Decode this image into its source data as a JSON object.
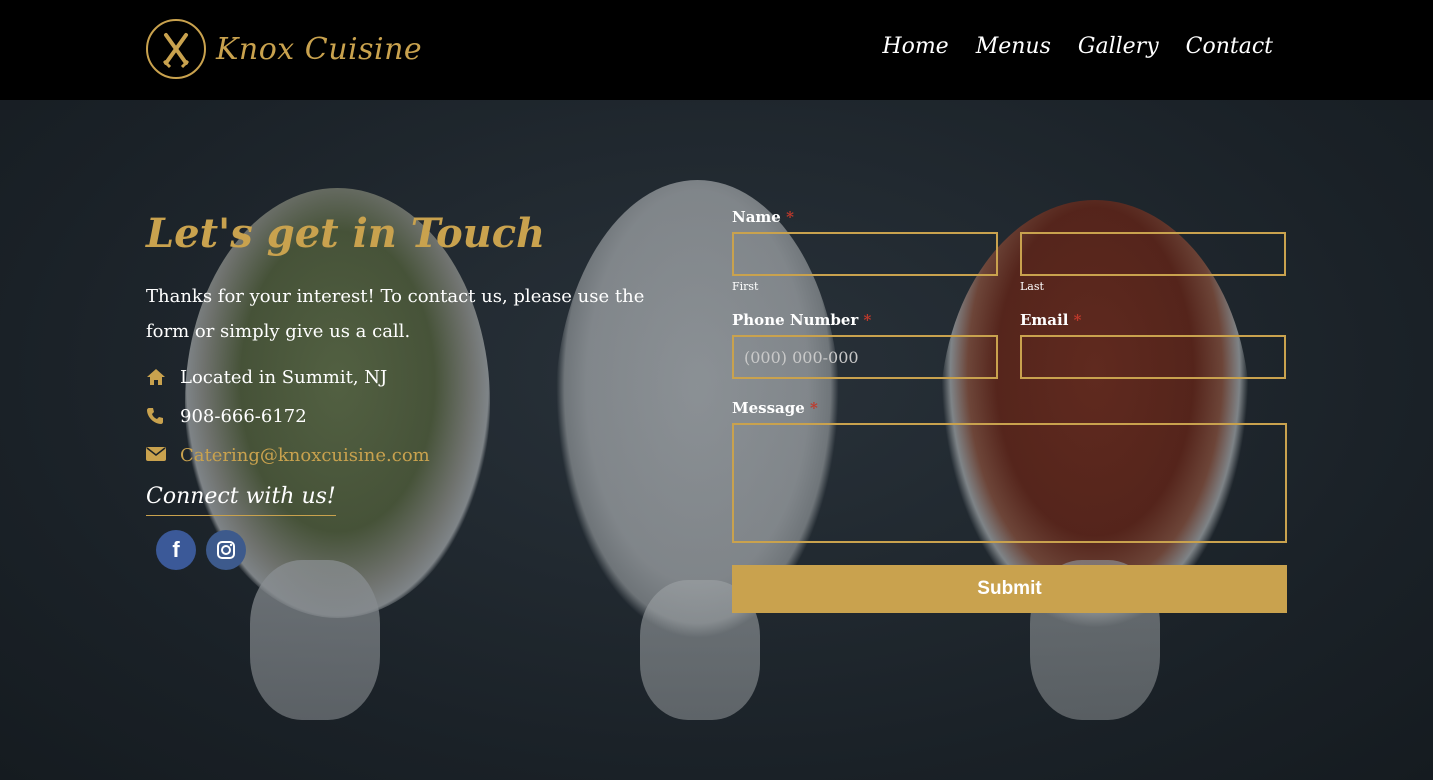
{
  "header": {
    "brand": "Knox Cuisine",
    "nav": [
      "Home",
      "Menus",
      "Gallery",
      "Contact"
    ]
  },
  "contact": {
    "title": "Let's get in Touch",
    "intro": "Thanks for your interest! To contact us, please use the form or simply give us a call.",
    "location": "Located in Summit, NJ",
    "phone": "908-666-6172",
    "email": "Catering@knoxcuisine.com",
    "connect": "Connect with us!",
    "social": [
      "f",
      "◎"
    ]
  },
  "form": {
    "name_label": "Name",
    "required_mark": "*",
    "first_label": "First",
    "last_label": "Last",
    "phone_label": "Phone Number",
    "phone_placeholder": "(000) 000-000",
    "email_label": "Email",
    "message_label": "Message",
    "submit_label": "Submit"
  },
  "colors": {
    "accent": "#c9a24e",
    "header_bg": "#000000",
    "facebook": "#3b5998"
  }
}
